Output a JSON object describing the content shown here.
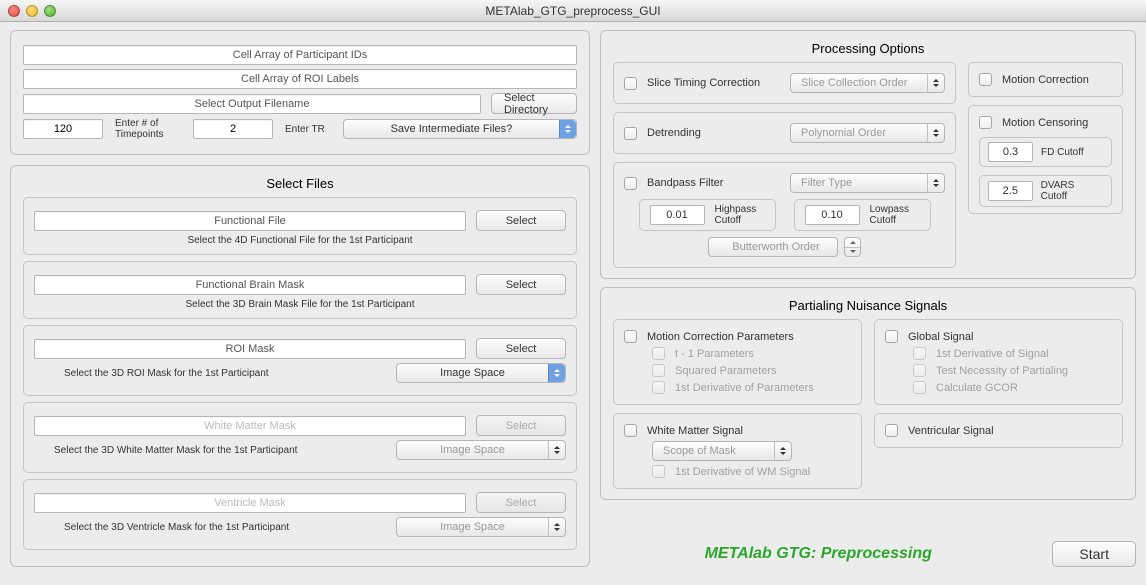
{
  "window": {
    "title": "METAlab_GTG_preprocess_GUI"
  },
  "top": {
    "participant_ids_ph": "Cell Array of Participant IDs",
    "roi_labels_ph": "Cell Array of ROI Labels",
    "output_filename_ph": "Select Output Filename",
    "select_directory": "Select Directory",
    "timepoints_value": "120",
    "timepoints_label": "Enter # of Timepoints",
    "tr_value": "2",
    "tr_label": "Enter TR",
    "save_intermediate": "Save Intermediate Files?"
  },
  "select_files": {
    "title": "Select Files",
    "functional": {
      "label": "Functional File",
      "btn": "Select",
      "hint": "Select the 4D Functional File for the 1st Participant"
    },
    "brainmask": {
      "label": "Functional Brain Mask",
      "btn": "Select",
      "hint": "Select the 3D Brain Mask File for the 1st Participant"
    },
    "roimask": {
      "label": "ROI Mask",
      "btn": "Select",
      "hint": "Select the 3D ROI Mask for the 1st Participant",
      "space": "Image Space"
    },
    "wm": {
      "label": "White Matter Mask",
      "btn": "Select",
      "hint": "Select the 3D White Matter Mask for the 1st Participant",
      "space": "Image Space"
    },
    "vent": {
      "label": "Ventricle Mask",
      "btn": "Select",
      "hint": "Select the 3D Ventricle Mask for the 1st Participant",
      "space": "Image Space"
    }
  },
  "processing": {
    "title": "Processing Options",
    "slice_timing": "Slice Timing Correction",
    "slice_order": "Slice Collection Order",
    "detrending": "Detrending",
    "poly_order": "Polynomial Order",
    "bandpass": "Bandpass Filter",
    "filter_type": "Filter Type",
    "hp_value": "0.01",
    "hp_label": "Highpass Cutoff",
    "lp_value": "0.10",
    "lp_label": "Lowpass Cutoff",
    "bw_order": "Butterworth Order",
    "motion_correction": "Motion Correction",
    "motion_censoring": "Motion Censoring",
    "fd_value": "0.3",
    "fd_label": "FD Cutoff",
    "dvars_value": "2.5",
    "dvars_label": "DVARS Cutoff"
  },
  "partialing": {
    "title": "Partialing Nuisance Signals",
    "motion_params": "Motion Correction Parameters",
    "t1": "t - 1 Parameters",
    "sq": "Squared Parameters",
    "d1": "1st Derivative of Parameters",
    "global": "Global Signal",
    "g_d1": "1st Derivative of Signal",
    "g_test": "Test Necessity of Partialing",
    "g_gcor": "Calculate GCOR",
    "wm": "White Matter Signal",
    "wm_scope": "Scope of Mask",
    "wm_d1": "1st Derivative of WM Signal",
    "vent": "Ventricular Signal"
  },
  "brand": "METAlab GTG: Preprocessing",
  "start": "Start"
}
